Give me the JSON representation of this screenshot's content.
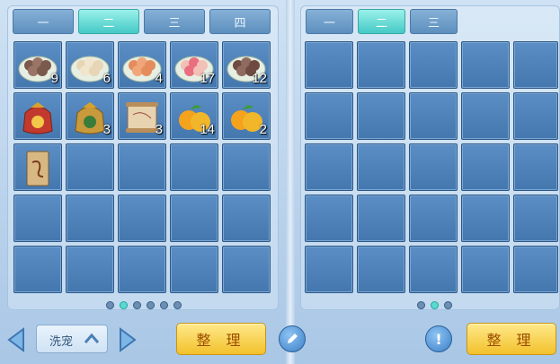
{
  "left_tabs": [
    "一",
    "二",
    "三",
    "四"
  ],
  "right_tabs": [
    "一",
    "二",
    "三"
  ],
  "active_left_tab": 1,
  "active_right_tab": 1,
  "left_items": [
    {
      "icon": "meatball-plate-icon",
      "count": "9"
    },
    {
      "icon": "dumpling-plate-icon",
      "count": "6"
    },
    {
      "icon": "fried-ball-plate-icon",
      "count": "4"
    },
    {
      "icon": "flower-cake-plate-icon",
      "count": "17"
    },
    {
      "icon": "brown-ball-plate-icon",
      "count": "12"
    },
    {
      "icon": "red-lucky-bag-icon",
      "count": ""
    },
    {
      "icon": "gold-lucky-bag-icon",
      "count": "3"
    },
    {
      "icon": "scroll-icon",
      "count": "3"
    },
    {
      "icon": "orange-fruit-icon",
      "count": "14"
    },
    {
      "icon": "orange-fruit-icon",
      "count": "2"
    },
    {
      "icon": "talisman-scroll-icon",
      "count": ""
    }
  ],
  "left_pages": 6,
  "left_active_page": 1,
  "right_pages": 3,
  "right_active_page": 1,
  "bottom": {
    "pet_select_label": "洗宠",
    "sort_label_left": "整 理",
    "sort_label_right": "整 理",
    "info_label": "!"
  }
}
